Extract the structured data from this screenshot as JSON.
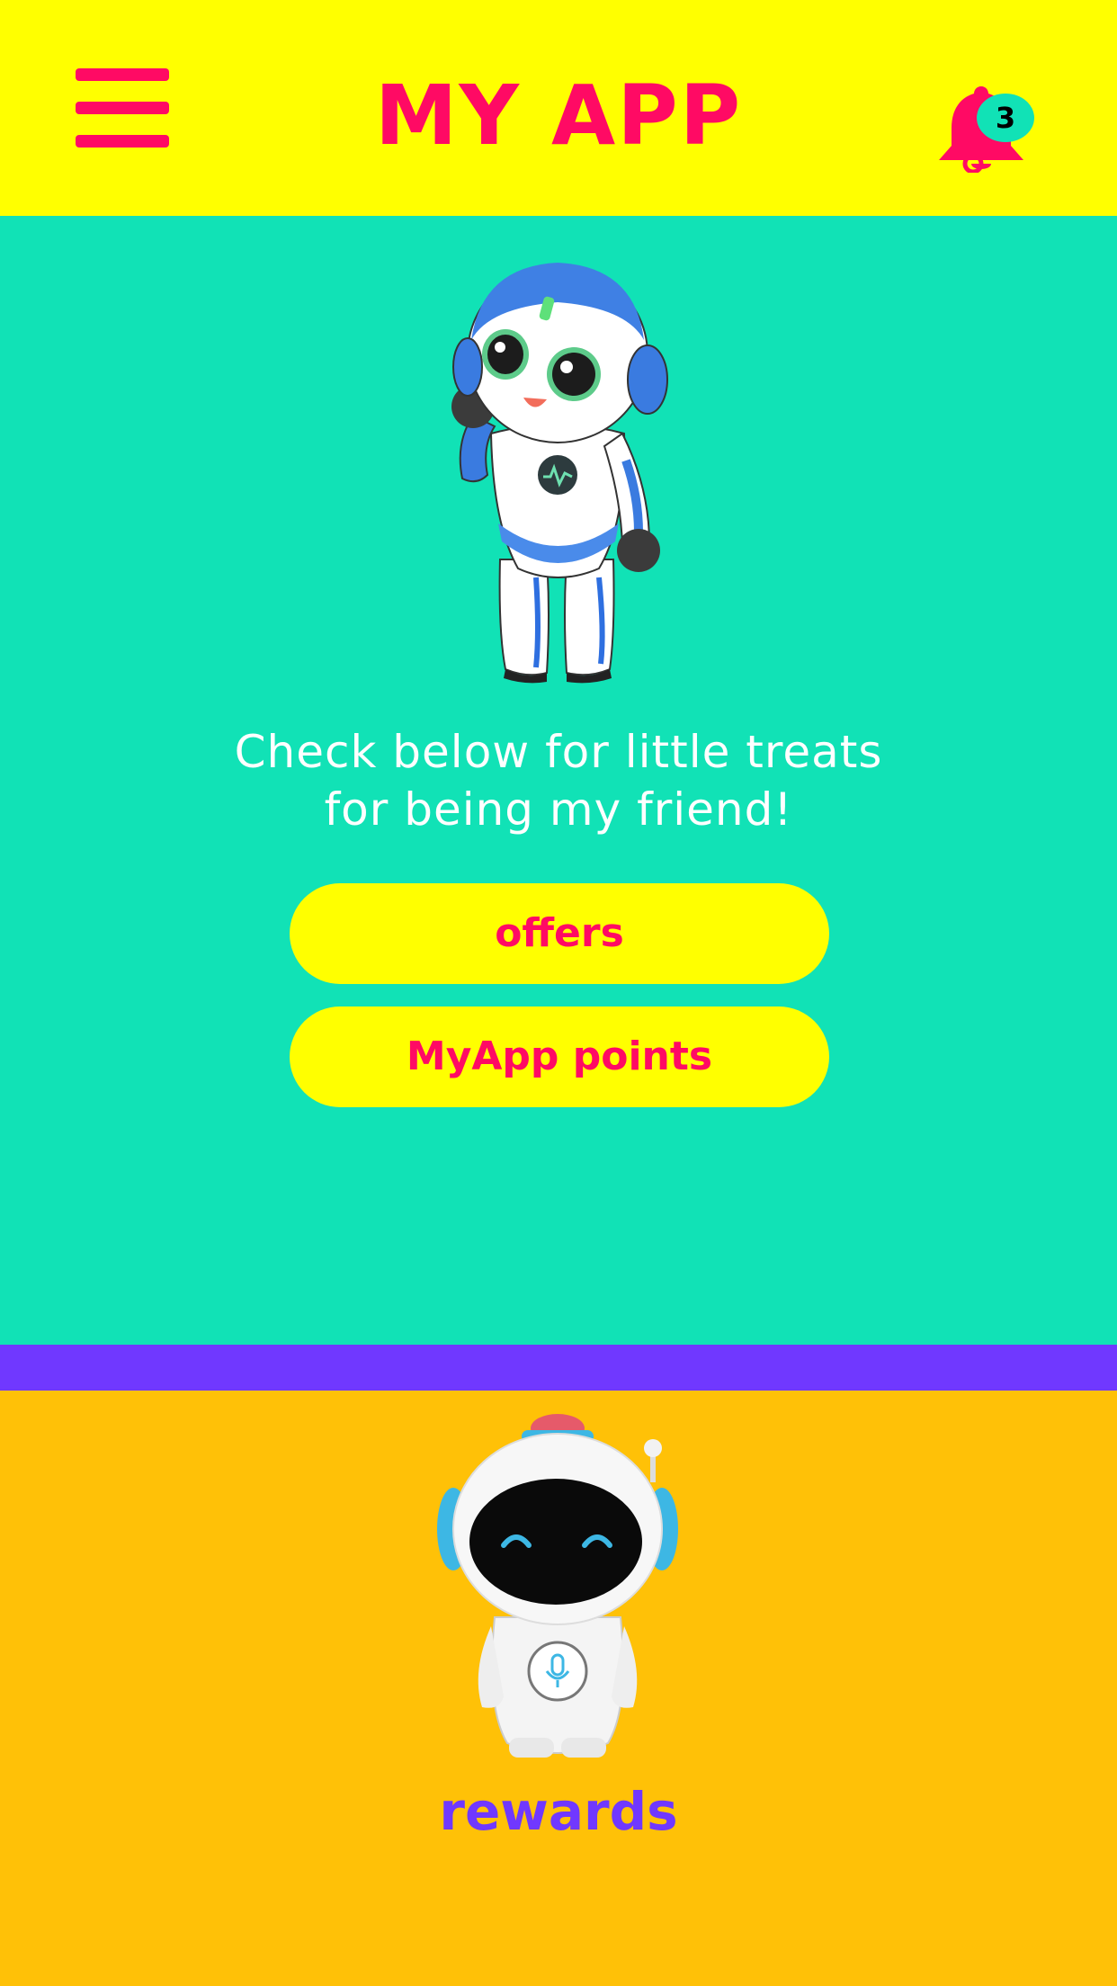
{
  "header": {
    "title": "MY APP",
    "menu_icon": "hamburger-menu-icon",
    "bell_icon": "bell-icon",
    "notification_count": "3"
  },
  "hero": {
    "line1": "Check below for little treats",
    "line2": "for being my friend!",
    "offers_label": "offers",
    "points_label": "MyApp points",
    "illustration": "blue-white-robot-illustration"
  },
  "rewards": {
    "label": "rewards",
    "illustration": "white-astronaut-robot-illustration"
  },
  "colors": {
    "header_bg": "#FFFF00",
    "accent_pink": "#FF0A64",
    "hero_bg": "#11E2B6",
    "stripe": "#7038FF",
    "rewards_bg": "#FFC107",
    "rewards_text": "#7038FF"
  }
}
